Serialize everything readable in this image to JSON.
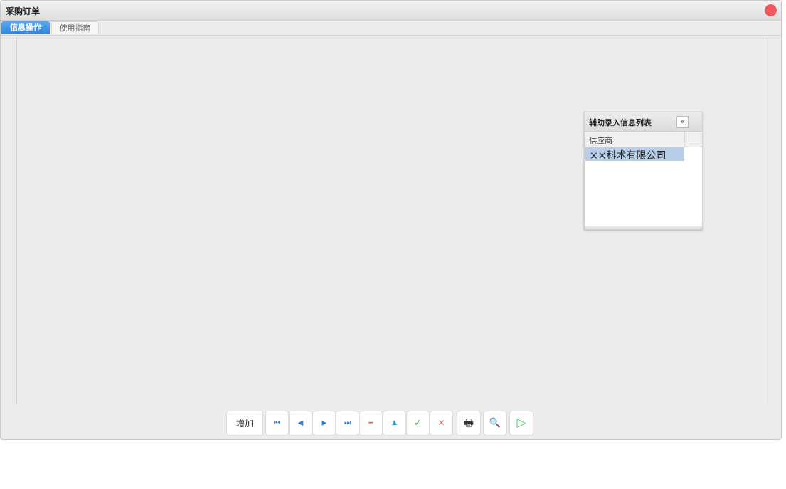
{
  "window": {
    "title": "采购订单"
  },
  "tabs": [
    {
      "label": "信息操作",
      "active": true
    },
    {
      "label": "使用指南",
      "active": false
    }
  ],
  "aux_panel": {
    "title": "辅助录入信息列表",
    "collapse_glyph": "«",
    "column_header": "供应商",
    "rows": [
      "××科术有限公司"
    ]
  },
  "toolbar": {
    "add_label": "增加",
    "icons": {
      "first": "⏮",
      "prev": "◀",
      "next": "▶",
      "last": "⏭",
      "delete": "━",
      "up": "▲",
      "confirm": "✓",
      "cancel": "✕",
      "print": "🖶",
      "preview": "🔍",
      "run": "▷"
    }
  },
  "colors": {
    "accent": "#2e86e0",
    "close": "#f05a5a",
    "selected_row": "#b7cde8",
    "nav_blue": "#2f7fd0",
    "delete_orange": "#e0651f",
    "up_teal": "#1ea0c8",
    "confirm_green": "#3aa84a",
    "cancel_red": "#e07070",
    "run_green": "#3ecf4f"
  }
}
